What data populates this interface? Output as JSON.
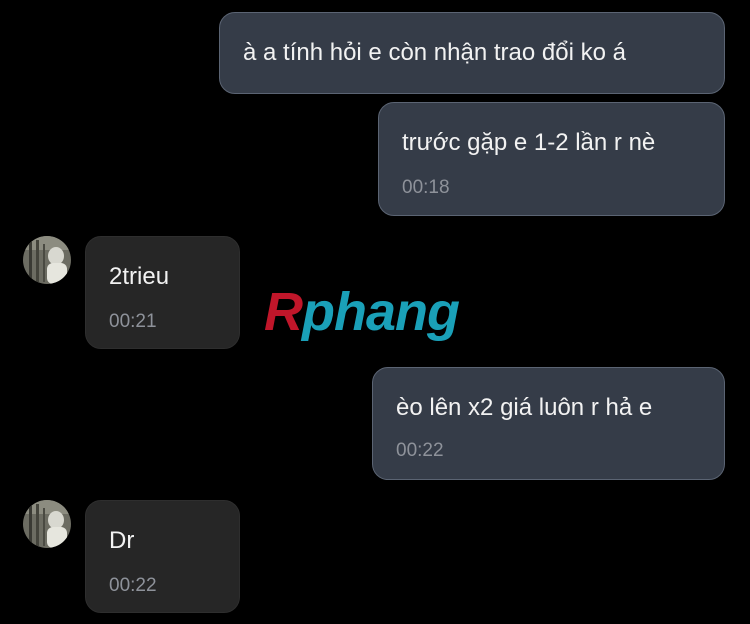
{
  "messages": [
    {
      "direction": "outgoing",
      "text": "à a tính hỏi e còn nhận trao đổi ko á",
      "time": ""
    },
    {
      "direction": "outgoing",
      "text": "trước gặp e 1-2 lần r nè",
      "time": "00:18"
    },
    {
      "direction": "incoming",
      "text": "2trieu",
      "time": "00:21"
    },
    {
      "direction": "outgoing",
      "text": "èo lên x2 giá luôn r hả e",
      "time": "00:22"
    },
    {
      "direction": "incoming",
      "text": "Dr",
      "time": "00:22"
    }
  ],
  "watermark": {
    "text": "Rphang",
    "colors": {
      "first_letter": "#c0162a",
      "rest": "#1aa0b8"
    }
  },
  "colors": {
    "background": "#000000",
    "outgoing_bubble": "#353c48",
    "outgoing_border": "#5b6473",
    "incoming_bubble": "#262626",
    "text": "#f2f2f2",
    "timestamp": "#8e929a"
  }
}
